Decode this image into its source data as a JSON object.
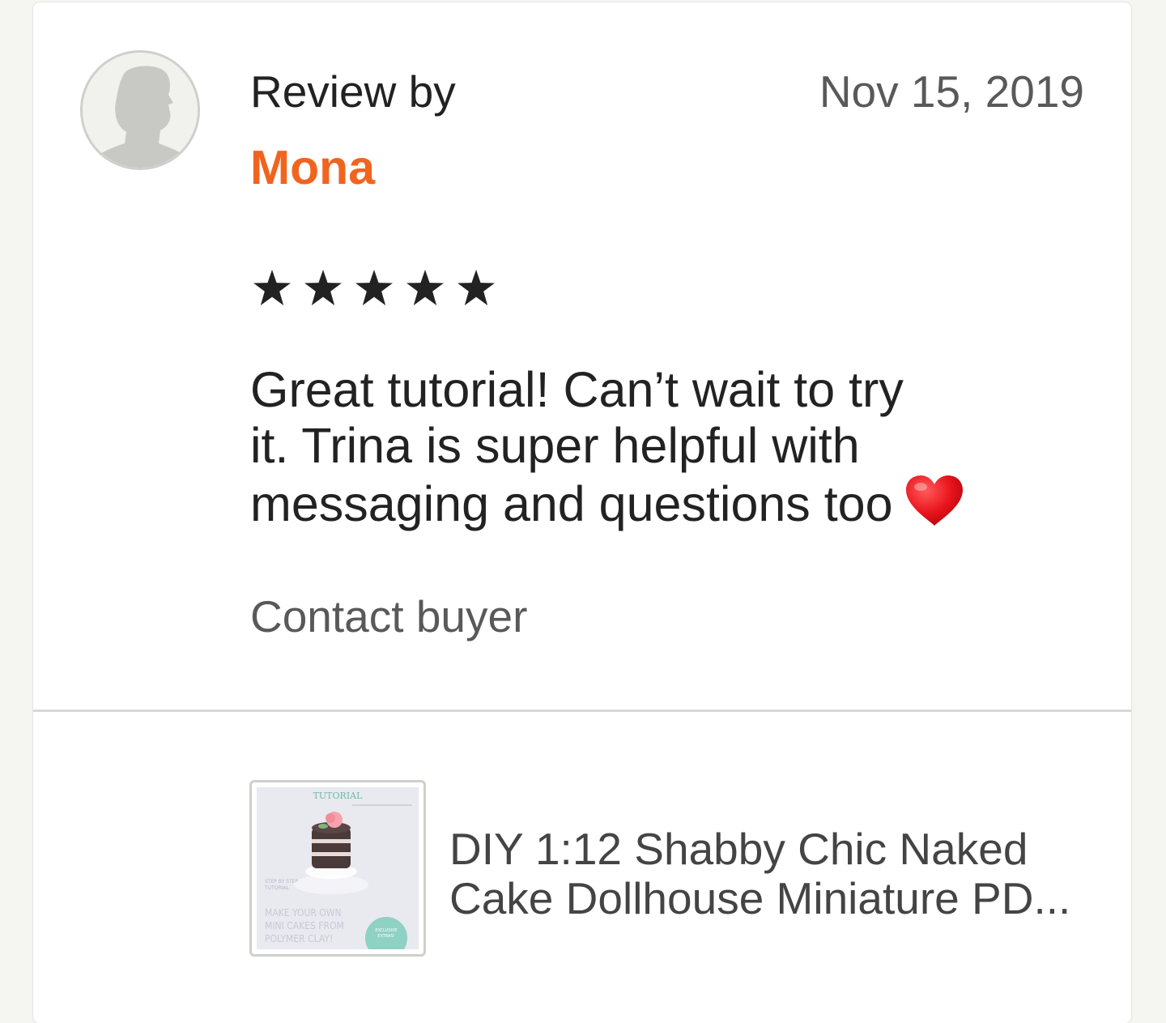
{
  "review": {
    "label": "Review by",
    "reviewer_name": "Mona",
    "date": "Nov 15, 2019",
    "rating": 5,
    "rating_max": 5,
    "text_lines": [
      "Great tutorial! Can’t wait to try",
      "it. Trina is super helpful with",
      "messaging and questions too"
    ],
    "emoji": "red-heart-icon",
    "contact_label": "Contact buyer"
  },
  "listing": {
    "title_lines": [
      "DIY 1:12 Shabby Chic Naked",
      "Cake Dollhouse Miniature PD..."
    ],
    "thumbnail": {
      "heading": "TUTORIAL",
      "side_text": [
        "STEP BY STEP",
        "TUTORIAL"
      ],
      "caption_lines": [
        "MAKE YOUR OWN",
        "MINI CAKES FROM",
        "POLYMER CLAY!"
      ],
      "badge_lines": [
        "EXCLUSIVE",
        "EXTRAS!"
      ]
    }
  },
  "colors": {
    "accent": "#f1641e",
    "text": "#222222",
    "muted": "#595959",
    "background": "#f5f5f1"
  }
}
